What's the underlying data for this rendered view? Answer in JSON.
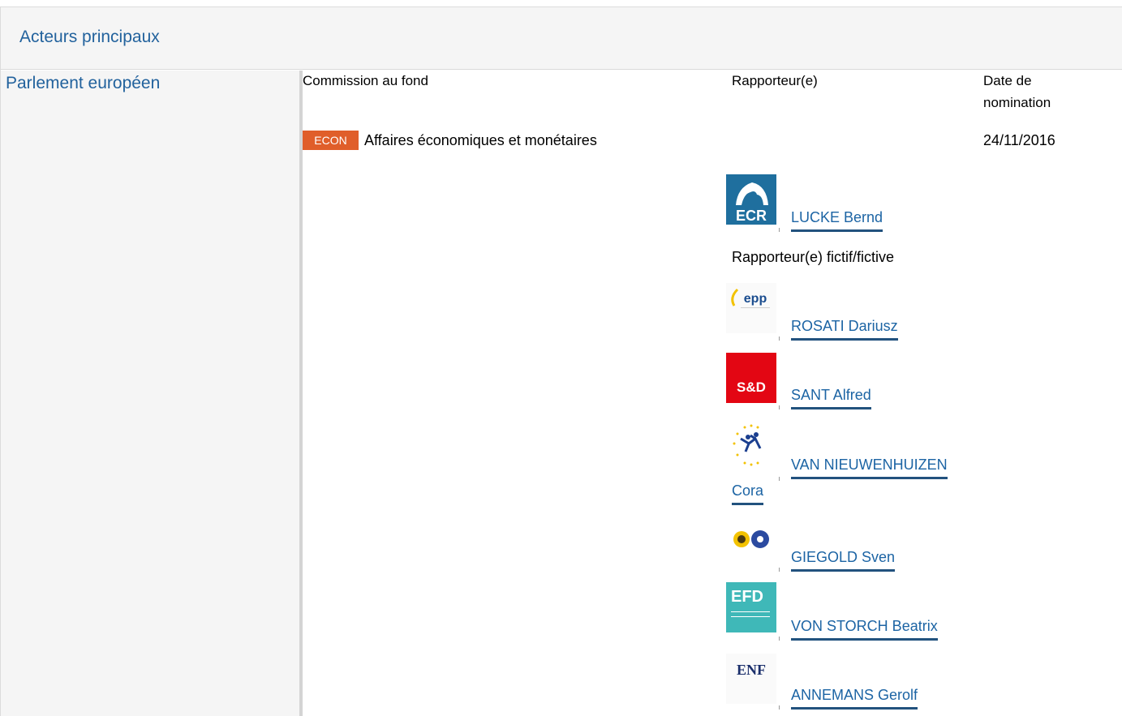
{
  "header": {
    "title": "Acteurs principaux"
  },
  "institution": {
    "label": "Parlement européen"
  },
  "columns": {
    "committee": "Commission au fond",
    "rapporteur": "Rapporteur(e)",
    "date_line1": "Date de",
    "date_line2": "nomination"
  },
  "committee": {
    "code": "ECON",
    "name": "Affaires économiques et monétaires",
    "date": "24/11/2016",
    "badge_color": "#e05e2a"
  },
  "rapporteur": {
    "name": "LUCKE Bernd",
    "group_logo": "ECR"
  },
  "shadow": {
    "label": "Rapporteur(e) fictif/fictive",
    "members": [
      {
        "name": "ROSATI Dariusz",
        "group_logo": "epp"
      },
      {
        "name": "SANT Alfred",
        "group_logo": "S&D"
      },
      {
        "name_line1": "VAN NIEUWENHUIZEN",
        "name_line2": "Cora",
        "group_logo": "ALDE"
      },
      {
        "name": "GIEGOLD Sven",
        "group_logo": "Greens/EFA"
      },
      {
        "name": "VON STORCH Beatrix",
        "group_logo": "EFD"
      },
      {
        "name": "ANNEMANS Gerolf",
        "group_logo": "ENF"
      }
    ]
  }
}
